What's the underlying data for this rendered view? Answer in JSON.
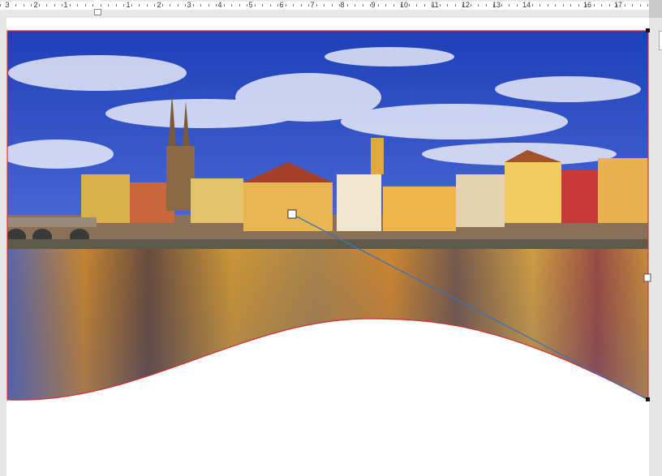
{
  "ruler": {
    "numbers": [
      "3",
      "2",
      "1",
      "1",
      "2",
      "3",
      "4",
      "5",
      "6",
      "7",
      "8",
      "9",
      "10",
      "11",
      "12",
      "13",
      "14",
      "16",
      "17"
    ]
  },
  "shape": {
    "kind": "wave-shaped picture",
    "outline_color": "#d32f2f",
    "connector_color": "#3b73b9"
  }
}
